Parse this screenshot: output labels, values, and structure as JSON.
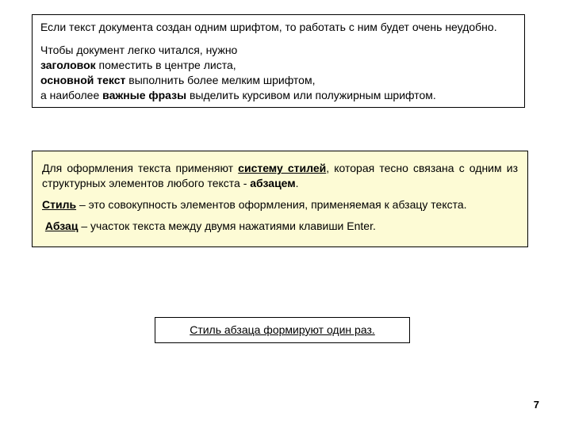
{
  "box1": {
    "p1": "Если текст документа создан одним шрифтом, то работать с ним будет очень неудобно.",
    "p2_line1": "Чтобы документ легко читался, нужно",
    "p2_line2_b": "заголовок",
    "p2_line2_rest": " поместить в центре листа,",
    "p2_line3_b": "основной текст",
    "p2_line3_rest": " выполнить более мелким шрифтом,",
    "p2_line4_a": "а наиболее ",
    "p2_line4_b": "важные фразы",
    "p2_line4_rest": " выделить курсивом или полужирным шрифтом."
  },
  "box2": {
    "p1_a": "Для оформления текста применяют ",
    "p1_b": "систему стилей",
    "p1_c": ", которая тесно связана с одним из структурных элементов любого текста - ",
    "p1_d": "абзацем",
    "p1_e": ".",
    "p2_a": "Стиль",
    "p2_b": " – это совокупность элементов оформления, применяемая к абзацу текста.",
    "p3_a": "Абзац",
    "p3_b": " – участок текста между двумя нажатиями клавиши Enter."
  },
  "box3": {
    "text": "Стиль абзаца формируют один раз."
  },
  "page": "7"
}
